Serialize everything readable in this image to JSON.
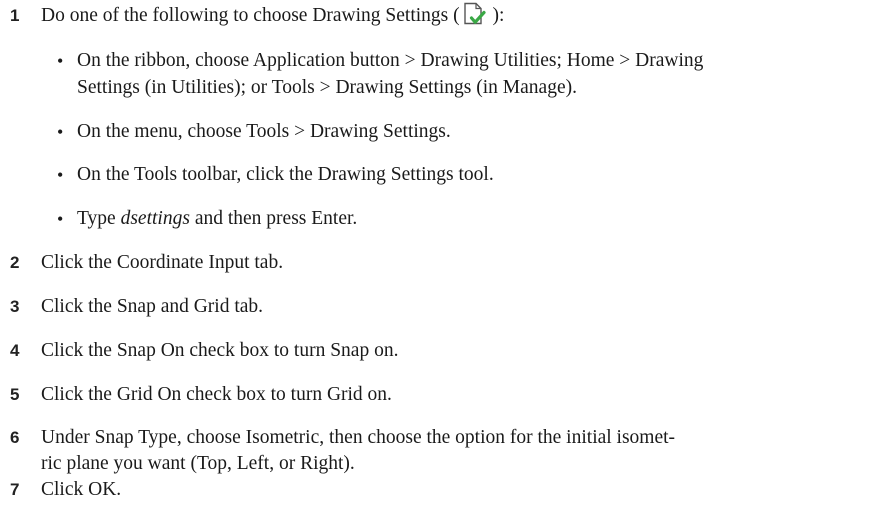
{
  "steps": [
    {
      "number": "1",
      "text_before_icon": "Do one of the following to choose Drawing Settings (",
      "icon_name": "drawing-settings-icon",
      "text_after_icon": " ):",
      "bullets": [
        {
          "line1": "On the ribbon, choose Application button > Drawing Utilities; Home > Drawing",
          "line2": "Settings (in Utilities); or Tools > Drawing Settings (in Manage)."
        },
        {
          "line1": "On the menu, choose Tools > Drawing Settings."
        },
        {
          "line1": "On the Tools toolbar, click the Drawing Settings tool."
        },
        {
          "prefix": "Type ",
          "emphasis": "dsettings",
          "suffix": " and then press Enter."
        }
      ]
    },
    {
      "number": "2",
      "text": "Click the Coordinate Input tab."
    },
    {
      "number": "3",
      "text": "Click the Snap and Grid tab."
    },
    {
      "number": "4",
      "text": "Click the Snap On check box to turn Snap on."
    },
    {
      "number": "5",
      "text": "Click the Grid On check box to turn Grid on."
    },
    {
      "number": "6",
      "line1": "Under Snap Type, choose Isometric, then choose the option for the initial isomet-",
      "line2": "ric plane you want (Top, Left, or Right)."
    },
    {
      "number": "7",
      "text": "Click OK."
    }
  ],
  "colors": {
    "icon_check": "#3aa845",
    "icon_page": "#555555"
  }
}
